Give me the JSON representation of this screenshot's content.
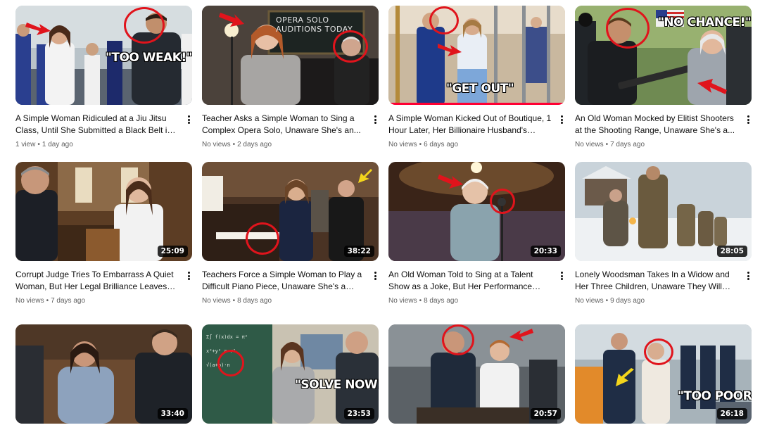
{
  "videos": [
    {
      "title": "A Simple Woman Ridiculed at a Jiu Jitsu Class, Until She Submitted a Black Belt in 1...",
      "views": "1 view",
      "age": "1 day ago",
      "duration": "",
      "caption": "\"TOO WEAK!\"",
      "progress": 0
    },
    {
      "title": "Teacher Asks a Simple Woman to Sing a Complex Opera Solo, Unaware She's an...",
      "views": "No views",
      "age": "2 days ago",
      "duration": "",
      "caption": "",
      "board_text": "OPERA SOLO AUDITIONS TODAY",
      "progress": 0
    },
    {
      "title": "A Simple Woman Kicked Out of Boutique, 1 Hour Later, Her Billionaire Husband's Black...",
      "views": "No views",
      "age": "6 days ago",
      "duration": "",
      "caption": "\"GET OUT\"",
      "progress": 1
    },
    {
      "title": "An Old Woman Mocked by Elitist Shooters at the Shooting Range, Unaware She's a...",
      "views": "No views",
      "age": "7 days ago",
      "duration": "",
      "caption": "\"NO CHANCE!\"",
      "progress": 0
    },
    {
      "title": "Corrupt Judge Tries To Embarrass A Quiet Woman, But Her Legal Brilliance Leaves Hi...",
      "views": "No views",
      "age": "7 days ago",
      "duration": "25:09",
      "caption": "",
      "progress": 0
    },
    {
      "title": "Teachers Force a Simple Woman to Play a Difficult Piano Piece, Unaware She's a Pian...",
      "views": "No views",
      "age": "8 days ago",
      "duration": "38:22",
      "caption": "",
      "progress": 0
    },
    {
      "title": "An Old Woman Told to Sing at a Talent Show as a Joke, But Her Performance Earns A...",
      "views": "No views",
      "age": "8 days ago",
      "duration": "20:33",
      "caption": "",
      "progress": 0
    },
    {
      "title": "Lonely Woodsman Takes In a Widow and Her Three Children, Unaware They Will Become...",
      "views": "No views",
      "age": "9 days ago",
      "duration": "28:05",
      "caption": "",
      "progress": 0
    },
    {
      "title": "",
      "views": "",
      "age": "",
      "duration": "33:40",
      "caption": "",
      "progress": 0
    },
    {
      "title": "",
      "views": "",
      "age": "",
      "duration": "23:53",
      "caption": "\"SOLVE NOW!\"",
      "progress": 0
    },
    {
      "title": "",
      "views": "",
      "age": "",
      "duration": "20:57",
      "caption": "",
      "progress": 0
    },
    {
      "title": "",
      "views": "",
      "age": "",
      "duration": "26:18",
      "caption": "\"TOO POOR!\"",
      "progress": 0
    }
  ],
  "colors": {
    "accent_red": "#e0141c",
    "progress_red": "#ff0033",
    "meta_gray": "#606060"
  },
  "icons": {
    "more": "more-vert-icon"
  }
}
